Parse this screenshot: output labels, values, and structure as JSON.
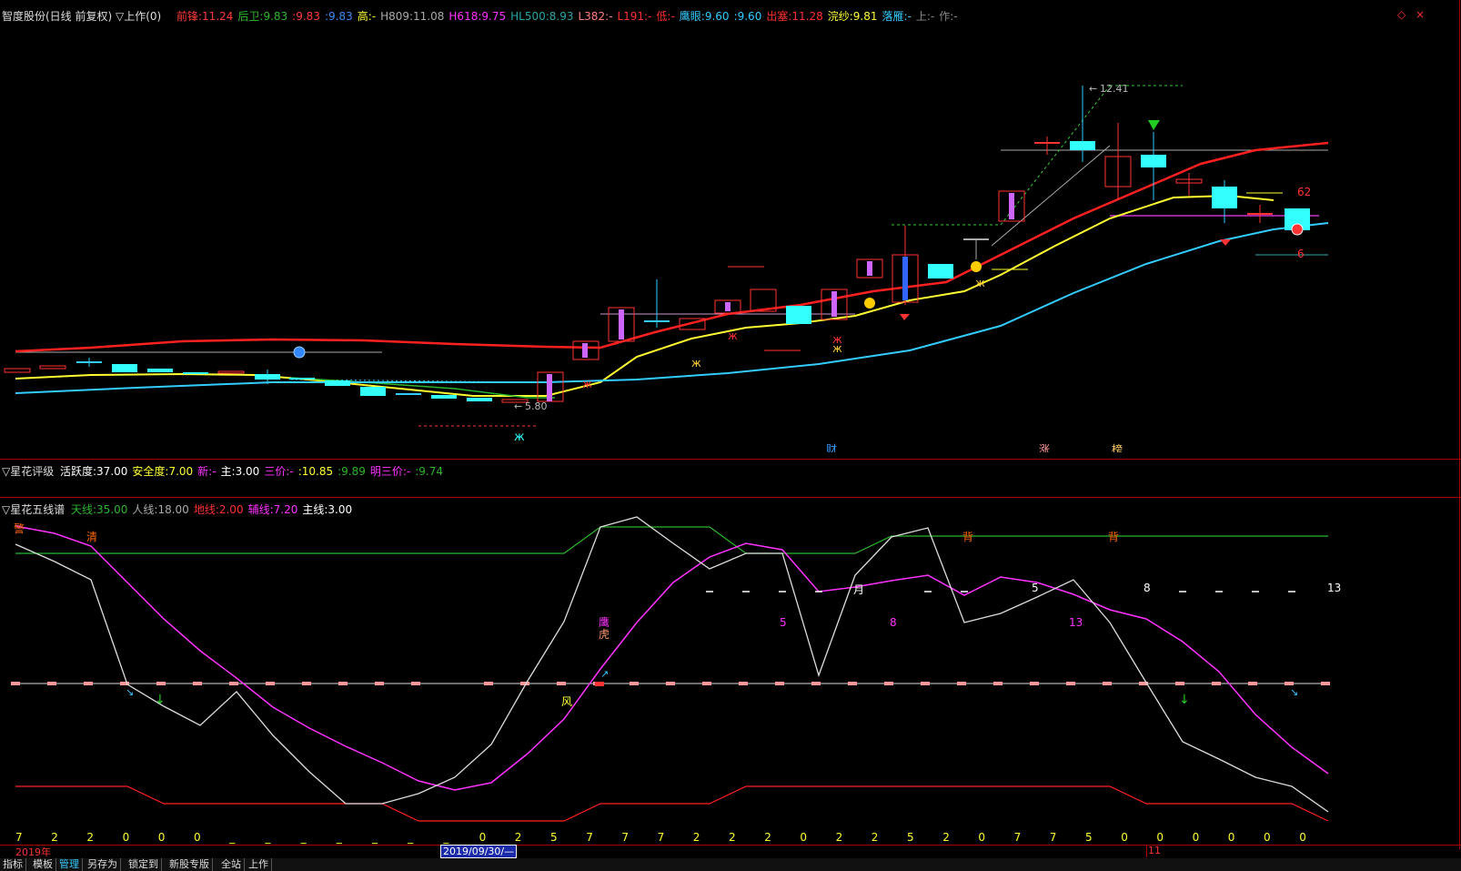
{
  "header": {
    "title": "智度股份(日线 前复权) ▽上作(0)",
    "values": [
      {
        "label": "前锋:",
        "value": "11.24",
        "color": "#ff3b3b"
      },
      {
        "label": "后卫:",
        "value": "9.83",
        "color": "#2db52d"
      },
      {
        "label": ":",
        "value": "9.83",
        "color": "#ff3b3b"
      },
      {
        "label": ":",
        "value": "9.83",
        "color": "#3a8df0"
      },
      {
        "label": "高:",
        "value": "-",
        "color": "#ffff33"
      },
      {
        "label": "H809:",
        "value": "11.08",
        "color": "#aaaaaa"
      },
      {
        "label": "H618:",
        "value": "9.75",
        "color": "#ff33ff"
      },
      {
        "label": "HL500:",
        "value": "8.93",
        "color": "#2aa3a3"
      },
      {
        "label": "L382:",
        "value": "-",
        "color": "#ff8080"
      },
      {
        "label": "L191:",
        "value": "-",
        "color": "#ff3030"
      },
      {
        "label": "低:",
        "value": "-",
        "color": "#ff3030"
      },
      {
        "label": "鹰眼:",
        "value": "9.60",
        "color": "#33ccff"
      },
      {
        "label": ":",
        "value": "9.60",
        "color": "#33ccff"
      },
      {
        "label": "出塞:",
        "value": "11.28",
        "color": "#ff3030"
      },
      {
        "label": "浣纱:",
        "value": "9.81",
        "color": "#ffff33"
      },
      {
        "label": "落雁:",
        "value": "-",
        "color": "#33ccff"
      },
      {
        "label": "上:",
        "value": "-",
        "color": "#888888"
      },
      {
        "label": "作:",
        "value": "-",
        "color": "#888888"
      }
    ]
  },
  "main_chart": {
    "high_label": "12.41",
    "low_label": "5.80",
    "right_label_1": "62",
    "right_label_2": "6",
    "markers": [
      "财",
      "涨",
      "榜"
    ]
  },
  "xinghua_rating": {
    "title": "▽星花评级",
    "items": [
      {
        "label": "活跃度:",
        "value": "37.00",
        "color": "#ffffff"
      },
      {
        "label": "安全度:",
        "value": "7.00",
        "color": "#ffff33"
      },
      {
        "label": "新:",
        "value": "-",
        "color": "#ff33ff"
      },
      {
        "label": "主:",
        "value": "3.00",
        "color": "#ffffff"
      },
      {
        "label": "三价:",
        "value": "-",
        "color": "#ff33ff"
      },
      {
        "label": ":",
        "value": "10.85",
        "color": "#ffff33"
      },
      {
        "label": ":",
        "value": "9.89",
        "color": "#2db52d"
      },
      {
        "label": "明三价:",
        "value": "-",
        "color": "#ff33ff"
      },
      {
        "label": ":",
        "value": "9.74",
        "color": "#2db52d"
      }
    ]
  },
  "xinghua_five": {
    "title": "▽星花五线谱",
    "items": [
      {
        "label": "天线:",
        "value": "35.00",
        "color": "#2db52d"
      },
      {
        "label": "人线:",
        "value": "18.00",
        "color": "#aaaaaa"
      },
      {
        "label": "地线:",
        "value": "2.00",
        "color": "#ff3030"
      },
      {
        "label": "辅线:",
        "value": "7.20",
        "color": "#ff33ff"
      },
      {
        "label": "主线:",
        "value": "3.00",
        "color": "#ffffff"
      }
    ],
    "signals": [
      "警",
      "清",
      "鹰",
      "虎",
      "风",
      "月",
      "背",
      "背"
    ],
    "magenta_nums": [
      "5",
      "8",
      "13"
    ],
    "white_nums": [
      "5",
      "8",
      "13"
    ],
    "bottom_digits": [
      "7",
      "2",
      "2",
      "0",
      "0",
      "0",
      "_",
      "_",
      "_",
      "_",
      "_",
      "_",
      "_",
      "0",
      "2",
      "5",
      "7",
      "7",
      "7",
      "2",
      "2",
      "2",
      "0",
      "2",
      "2",
      "5",
      "2",
      "0",
      "7",
      "7",
      "5",
      "0",
      "0",
      "0",
      "0",
      "0",
      "0"
    ]
  },
  "date_axis": {
    "year": "2019年",
    "cursor_date": "2019/09/30/—",
    "month": "11"
  },
  "tabs": [
    "指标",
    "模板",
    "管理",
    "另存为",
    "锁定到",
    "新股专版",
    "全站",
    "上作"
  ],
  "active_tab": "管理"
}
